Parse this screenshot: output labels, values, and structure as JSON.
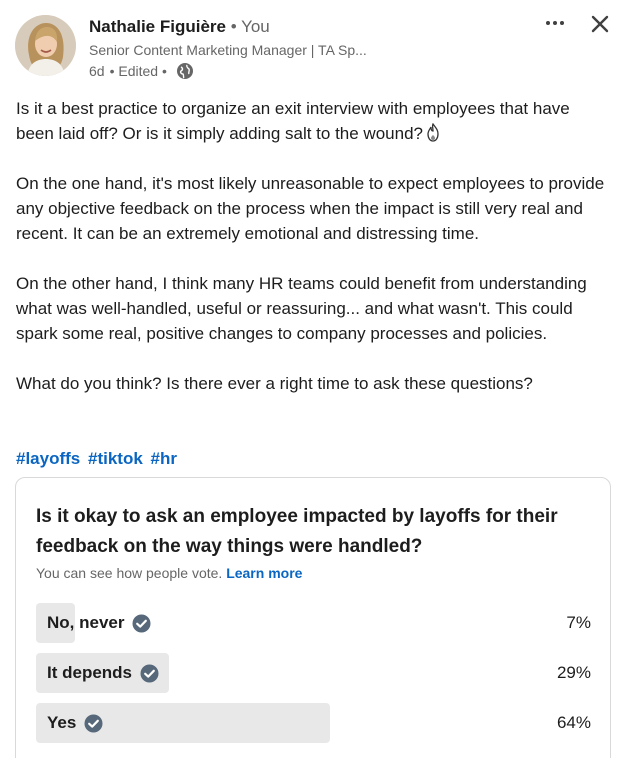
{
  "post": {
    "author": {
      "name": "Nathalie Figuière",
      "you_label": " • You",
      "headline": "Senior Content Marketing Manager | TA Sp...",
      "time": "6d",
      "edited": "• Edited •"
    },
    "paragraphs": [
      "Is it a best practice to organize an exit interview with employees that have been laid off? Or is it simply adding salt to the wound?",
      "On the one hand, it's most likely unreasonable to expect employees to provide any objective feedback on the process when the impact is still very real and recent. It can be an extremely emotional and distressing time.",
      "On the other hand, I think many HR teams could benefit from understanding what was well-handled, useful or reassuring... and what wasn't. This could spark some real, positive changes to company processes and policies.",
      "What do you think? Is there ever a right time to ask these questions?"
    ],
    "hashtags": [
      "#layoffs",
      "#tiktok",
      "#hr"
    ]
  },
  "poll": {
    "question": "Is it okay to ask an employee impacted by layoffs for their feedback on the way things were handled?",
    "visibility_text": "You can see how people vote.",
    "learn_more": "Learn more",
    "options": [
      {
        "label": "No, never",
        "percent": "7%",
        "fraction": 0.07
      },
      {
        "label": "It depends",
        "percent": "29%",
        "fraction": 0.24
      },
      {
        "label": "Yes",
        "percent": "64%",
        "fraction": 0.53
      }
    ]
  },
  "icons": {
    "more": "more-icon",
    "close": "close-icon",
    "globe": "globe-icon",
    "check": "check-circle-icon",
    "flame": "flame-emoji-icon"
  },
  "colors": {
    "link": "#0a66c2",
    "bar_fill": "#e8e8e8",
    "check": "#56687a",
    "muted": "#666666"
  }
}
